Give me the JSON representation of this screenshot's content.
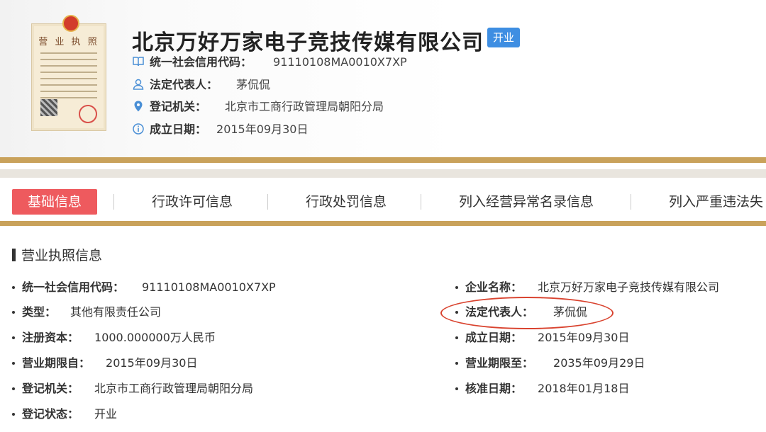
{
  "company": {
    "name": "北京万好万家电子竞技传媒有限公司",
    "status": "开业",
    "license_image": {
      "title": "营 业 执 照"
    },
    "credit_code_label": "统一社会信用代码：",
    "credit_code": "91110108MA0010X7XP",
    "legal_rep_label": "法定代表人：",
    "legal_rep": "茅侃侃",
    "authority_label": "登记机关：",
    "authority": "北京市工商行政管理局朝阳分局",
    "founded_label": "成立日期：",
    "founded": "2015年09月30日"
  },
  "tabs": [
    {
      "label": "基础信息",
      "active": true
    },
    {
      "label": "行政许可信息",
      "active": false
    },
    {
      "label": "行政处罚信息",
      "active": false
    },
    {
      "label": "列入经营异常名录信息",
      "active": false
    },
    {
      "label": "列入严重违法失",
      "active": false
    }
  ],
  "section": {
    "title": "营业执照信息",
    "left_fields": [
      {
        "label": "统一社会信用代码：",
        "value": "91110108MA0010X7XP"
      },
      {
        "label": "类型：",
        "value": "其他有限责任公司"
      },
      {
        "label": "注册资本：",
        "value": "1000.000000万人民币"
      },
      {
        "label": "营业期限自：",
        "value": "2015年09月30日"
      },
      {
        "label": "登记机关：",
        "value": "北京市工商行政管理局朝阳分局"
      },
      {
        "label": "登记状态：",
        "value": "开业"
      }
    ],
    "right_fields": [
      {
        "label": "企业名称：",
        "value": "北京万好万家电子竞技传媒有限公司"
      },
      {
        "label": "法定代表人：",
        "value": "茅侃侃"
      },
      {
        "label": "成立日期：",
        "value": "2015年09月30日"
      },
      {
        "label": "营业期限至：",
        "value": "2035年09月29日"
      },
      {
        "label": "核准日期：",
        "value": "2018年01月18日"
      }
    ]
  },
  "colors": {
    "accent_gold": "#c9a25b",
    "active_tab": "#ee5a5e",
    "status_tag": "#3e8ee2",
    "annotation": "#d9432f",
    "icon_blue": "#4a8fd6"
  },
  "icons": [
    "book-icon",
    "person-icon",
    "location-pin-icon",
    "info-icon"
  ]
}
